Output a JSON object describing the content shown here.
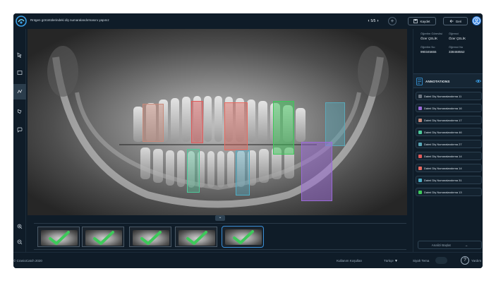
{
  "header": {
    "instruction": "Rntgen görüntülerindeki diş numaralandırmasını yapınız",
    "pager": "5/5",
    "save_label": "Kaydet",
    "back_label": "Geri"
  },
  "patient": {
    "doctor_label": "Öğretim Görevlisi",
    "doctor_name": "Özer ÇELİK",
    "student_label": "Öğrenci",
    "student_name": "Özer ÇELİK",
    "id_label": "Öğretim No",
    "id_value": "990345655",
    "student_id_label": "Öğrenci No",
    "student_id_value": "338468552"
  },
  "annotations": {
    "title": "ANNOTATIONS",
    "items": [
      {
        "label": "Daimi Diş Numaralandırma 11",
        "color": "#6b7580"
      },
      {
        "label": "Daimi Diş Numaralandırma 16",
        "color": "#9b6ad8"
      },
      {
        "label": "Daimi Diş Numaralandırma 17",
        "color": "#c98a7a"
      },
      {
        "label": "Daimi Diş Numaralandırma 46",
        "color": "#4fc89a"
      },
      {
        "label": "Daimi Diş Numaralandırma 27",
        "color": "#5aa8b8"
      },
      {
        "label": "Daimi Diş Numaralandırma 14",
        "color": "#e05a5a"
      },
      {
        "label": "Daimi Diş Numaralandırma 14",
        "color": "#e86a60"
      },
      {
        "label": "Daimi Diş Numaralandırma 31",
        "color": "#4fb0c8"
      },
      {
        "label": "Daimi Diş Numaralandırma 13",
        "color": "#3ec85a"
      }
    ],
    "analyze_label": "Analizi Başlat"
  },
  "footer": {
    "copyright": "© CranioCatch 2020",
    "terms": "Kullanım Koşulları",
    "language": "Türkçe",
    "theme_label": "Siyah Tema",
    "extra": "Yardım"
  },
  "colors": {
    "background": "#0f1c28",
    "accent": "#2e7fe0"
  }
}
